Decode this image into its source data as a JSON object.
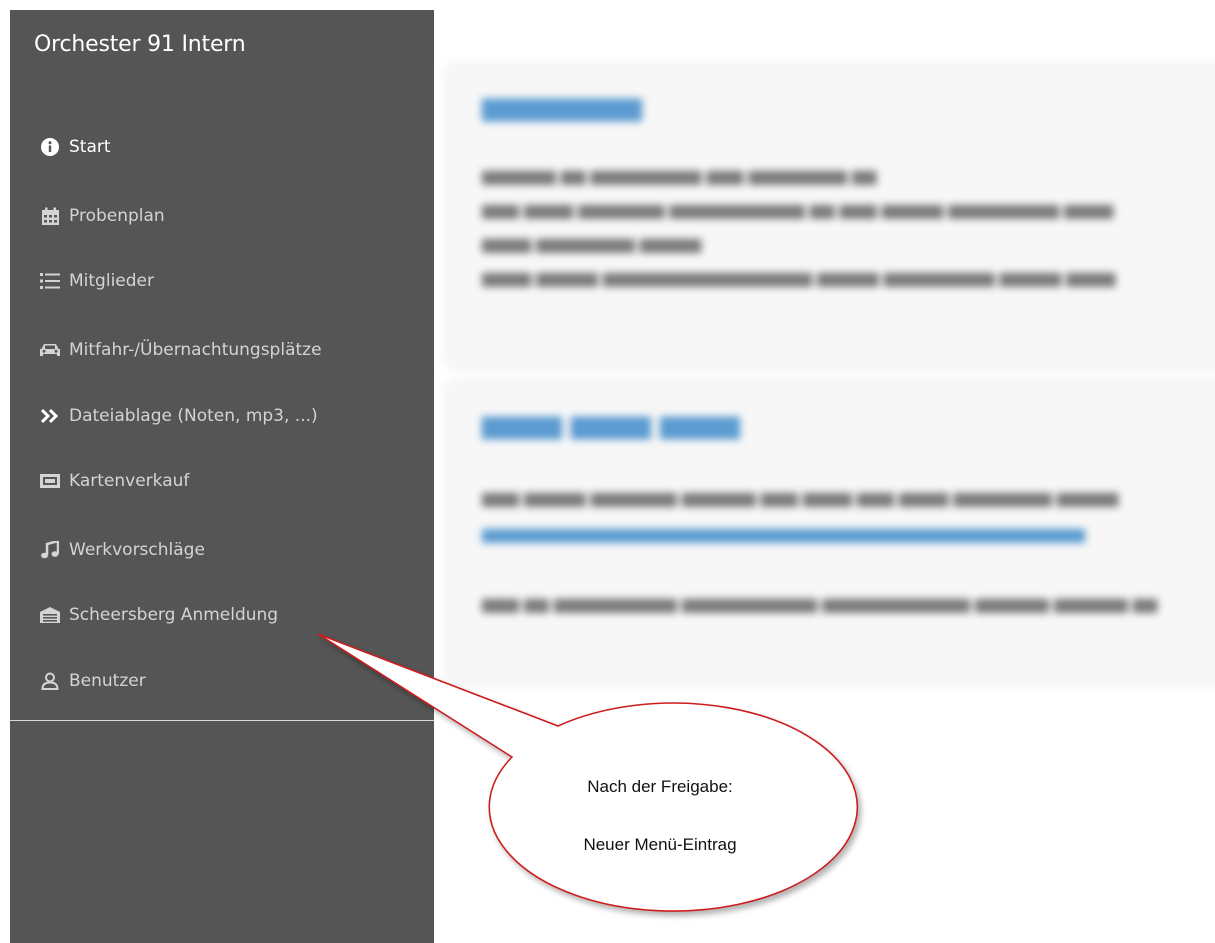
{
  "app": {
    "title": "Orchester 91 Intern"
  },
  "sidebar": {
    "items": [
      {
        "label": "Start",
        "icon": "info-circle-icon",
        "active": true
      },
      {
        "label": "Probenplan",
        "icon": "calendar-icon"
      },
      {
        "label": "Mitglieder",
        "icon": "list-icon"
      },
      {
        "label": "Mitfahr-/Übernachtungsplätze",
        "icon": "car-icon"
      },
      {
        "label": "Dateiablage (Noten, mp3, ...)",
        "icon": "double-chevron-right-icon"
      },
      {
        "label": "Kartenverkauf",
        "icon": "ticket-icon"
      },
      {
        "label": "Werkvorschläge",
        "icon": "music-note-icon"
      },
      {
        "label": "Scheersberg Anmeldung",
        "icon": "building-icon"
      },
      {
        "label": "Benutzer",
        "icon": "user-icon"
      }
    ]
  },
  "callout": {
    "line1": "Nach der Freigabe:",
    "line2": "Neuer Menü-Eintrag"
  },
  "colors": {
    "sidebar_bg": "#555555",
    "nav_text": "#d4d4d4",
    "active_text": "#ffffff",
    "accent_blue": "#5b9bd1",
    "callout_border": "#cc1f1f"
  }
}
